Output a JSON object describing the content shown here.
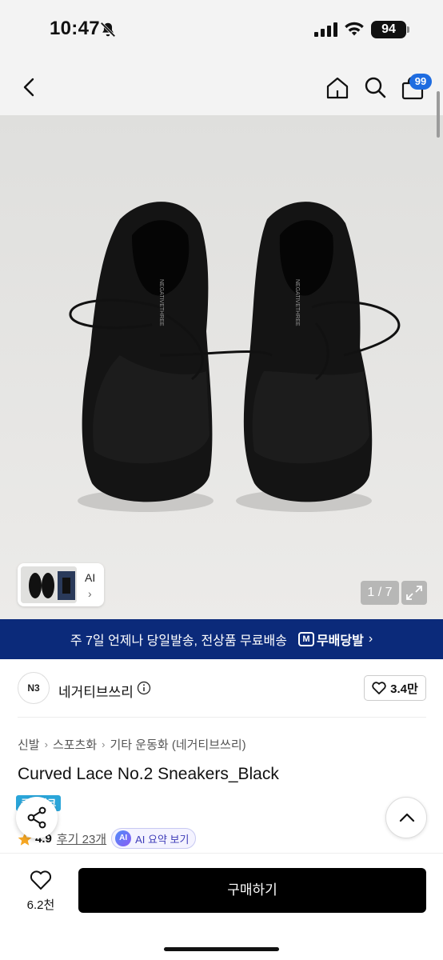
{
  "status_bar": {
    "time": "10:47",
    "battery": "94",
    "icons": [
      "bell-muted-icon",
      "cellular-signal-icon",
      "wifi-icon",
      "battery-icon"
    ]
  },
  "nav": {
    "icons": [
      "back-arrow-icon",
      "home-icon",
      "search-icon",
      "shopping-bag-icon"
    ],
    "cart_badge": "99"
  },
  "gallery": {
    "thumbnail_label": "AI",
    "counter": "1 / 7",
    "icons": [
      "chevron-right-icon",
      "expand-icon"
    ]
  },
  "shipping_banner": {
    "text": "주 7일 언제나 당일발송, 전상품 무료배송",
    "logo_text": "무배당발",
    "logo_mark": "M"
  },
  "brand": {
    "logo_text": "N3",
    "name": "네거티브쓰리",
    "likes": "3.4만"
  },
  "breadcrumb": [
    "신발",
    "스포츠화",
    "기타 운동화 (네거티브쓰리)"
  ],
  "product": {
    "title": "Curved Lace No.2 Sneakers_Black",
    "tag": "큐레이크",
    "rating": "4.9",
    "reviews": "후기 23개",
    "ai_summary": "AI 요약 보기",
    "ai_badge": "AI"
  },
  "bottom_bar": {
    "like_count": "6.2천",
    "buy_label": "구매하기"
  },
  "colors": {
    "banner_bg": "#0b2a7a",
    "badge_blue": "#1e6ce0",
    "buy_button": "#000000",
    "star": "#f5a623"
  }
}
